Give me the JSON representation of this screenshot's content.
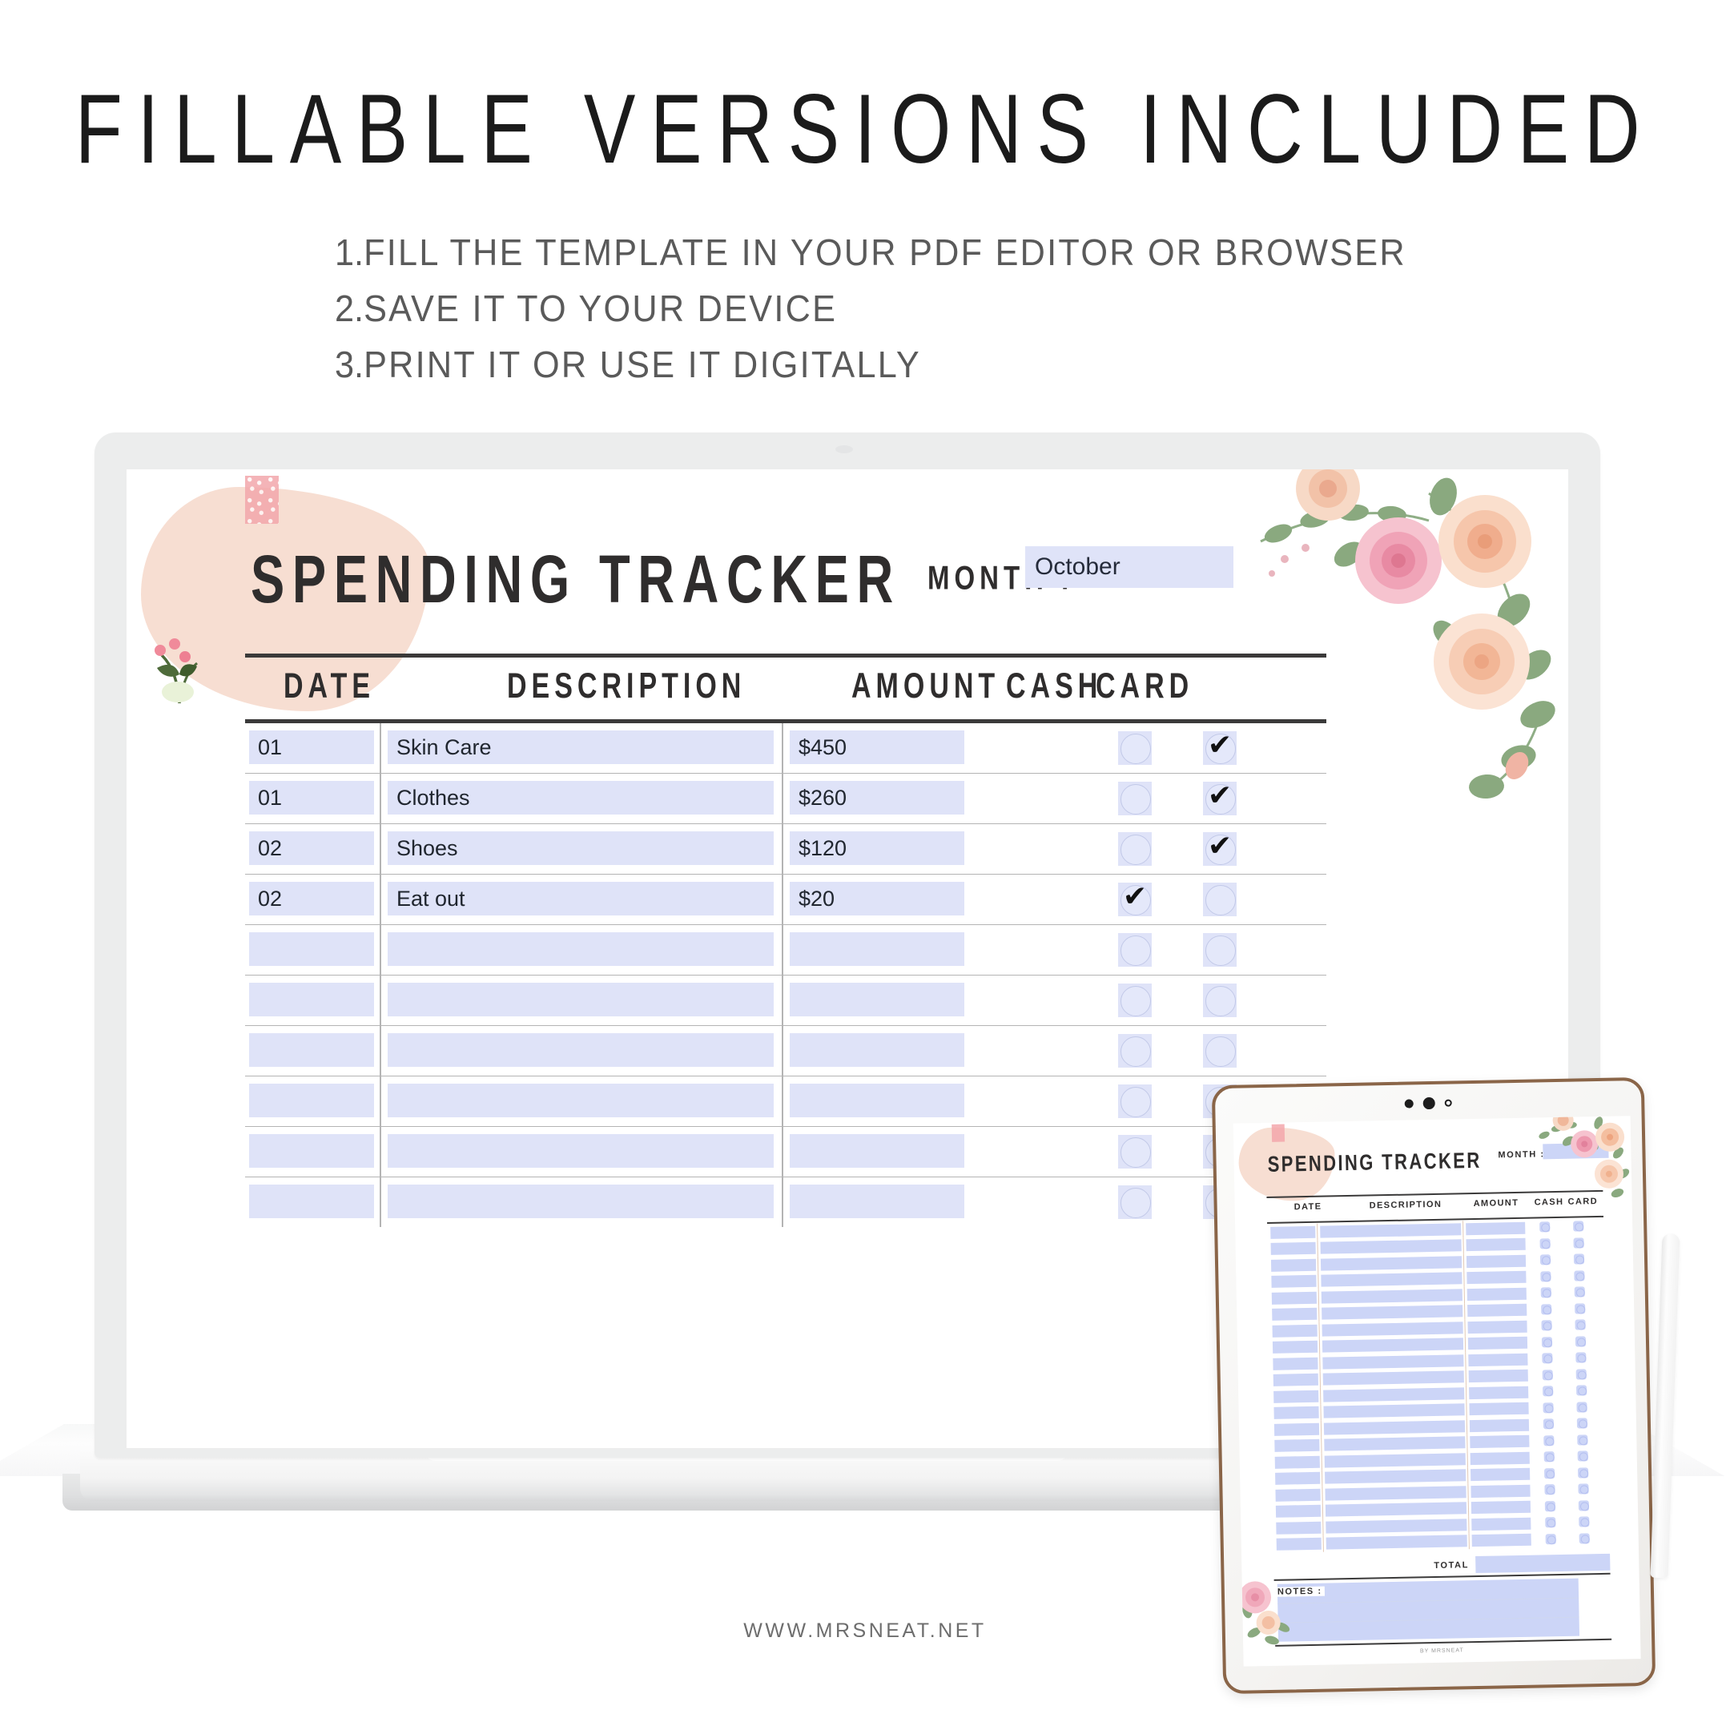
{
  "headline": "FILLABLE  VERSIONS  INCLUDED",
  "steps": [
    {
      "num": "1.",
      "text": "FILL THE TEMPLATE IN YOUR PDF EDITOR OR BROWSER"
    },
    {
      "num": "2.",
      "text": "SAVE IT TO YOUR DEVICE"
    },
    {
      "num": "3.",
      "text": "PRINT IT OR USE IT DIGITALLY"
    }
  ],
  "footer": "WWW.MRSNEAT.NET",
  "printable": {
    "title": "SPENDING TRACKER",
    "month_label": "MONTH :",
    "month_value": "October",
    "columns": {
      "date": "DATE",
      "description": "DESCRIPTION",
      "amount": "AMOUNT",
      "cash": "CASH",
      "card": "CARD"
    },
    "check_mark": "✔",
    "rows": [
      {
        "date": "01",
        "description": "Skin Care",
        "amount": "$450",
        "cash": false,
        "card": true
      },
      {
        "date": "01",
        "description": "Clothes",
        "amount": "$260",
        "cash": false,
        "card": true
      },
      {
        "date": "02",
        "description": "Shoes",
        "amount": "$120",
        "cash": false,
        "card": true
      },
      {
        "date": "02",
        "description": "Eat out",
        "amount": "$20",
        "cash": true,
        "card": false
      },
      {
        "date": "",
        "description": "",
        "amount": "",
        "cash": false,
        "card": false
      },
      {
        "date": "",
        "description": "",
        "amount": "",
        "cash": false,
        "card": false
      },
      {
        "date": "",
        "description": "",
        "amount": "",
        "cash": false,
        "card": false
      },
      {
        "date": "",
        "description": "",
        "amount": "",
        "cash": false,
        "card": false
      },
      {
        "date": "",
        "description": "",
        "amount": "",
        "cash": false,
        "card": false
      },
      {
        "date": "",
        "description": "",
        "amount": "",
        "cash": false,
        "card": false
      }
    ]
  },
  "tablet": {
    "title": "SPENDING TRACKER",
    "month_label": "MONTH :",
    "month_value": "",
    "columns": {
      "date": "DATE",
      "description": "DESCRIPTION",
      "amount": "AMOUNT",
      "cash": "CASH",
      "card": "CARD"
    },
    "total_label": "TOTAL",
    "notes_label": "NOTES :",
    "credit": "BY MRSNEAT",
    "row_count": 20
  },
  "colors": {
    "field_fill": "#dfe3f8",
    "tablet_field_fill": "#ccd5f7",
    "blush": "#f7ded2",
    "tape_pink": "#f3a7ac",
    "rule": "#3b3a3a",
    "text_dark": "#2f2d2d",
    "text_muted": "#5a5a5a"
  }
}
